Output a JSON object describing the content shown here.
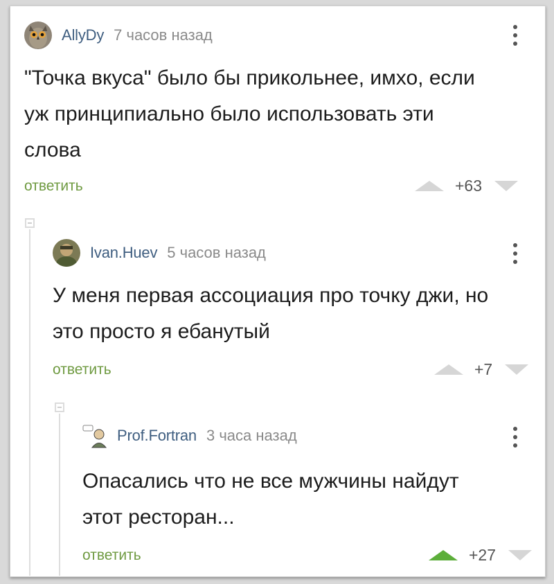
{
  "comments": [
    {
      "username": "AllyDy",
      "time": "7 часов назад",
      "lines": [
        "\"Точка вкуса\" было бы прикольнее, имхо, если",
        "уж принципиально было использовать эти",
        "слова"
      ],
      "reply_label": "ответить",
      "rating": "+63",
      "upvoted": false,
      "avatar_icon": "owl-avatar"
    },
    {
      "username": "Ivan.Huev",
      "time": "5 часов назад",
      "lines": [
        "У меня первая ассоциация про точку джи, но",
        "это просто я ебанутый"
      ],
      "reply_label": "ответить",
      "rating": "+7",
      "upvoted": false,
      "avatar_icon": "photo-avatar"
    },
    {
      "username": "Prof.Fortran",
      "time": "3 часа назад",
      "lines": [
        "Опасались что не все мужчины найдут",
        "этот ресторан..."
      ],
      "reply_label": "ответить",
      "rating": "+27",
      "upvoted": true,
      "avatar_icon": "cartoon-avatar"
    }
  ],
  "colors": {
    "username": "#3f5e80",
    "reply": "#6f9a41",
    "upvote_active": "#5cae3a",
    "inactive_arrow": "#d6d6d6"
  }
}
